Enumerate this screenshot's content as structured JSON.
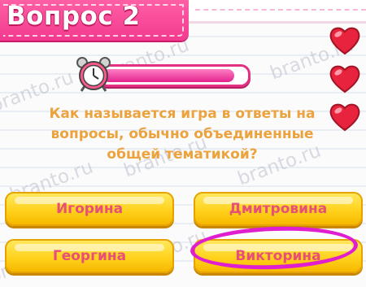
{
  "header": {
    "title": "Вопрос 2"
  },
  "lives": {
    "count": 3,
    "icon": "heart-icon",
    "color": "#e8233e"
  },
  "timer": {
    "progress": 0.95,
    "icon": "alarm-clock-icon",
    "color": "#e2238d"
  },
  "question": {
    "lines": [
      "Как называется игра в ответы на",
      "вопросы, обычно объединенные",
      "общей тематикой?"
    ]
  },
  "answers": [
    {
      "label": "Игорина"
    },
    {
      "label": "Дмитровина"
    },
    {
      "label": "Георгина"
    },
    {
      "label": "Викторина",
      "highlighted": true
    }
  ],
  "watermark": {
    "text": "branto.ru"
  },
  "colors": {
    "accent": "#f23a8f",
    "question_text": "#eca23d",
    "answer_text": "#e74f78",
    "answer_bg": "#ffd21c",
    "highlight": "#e01ed0"
  }
}
